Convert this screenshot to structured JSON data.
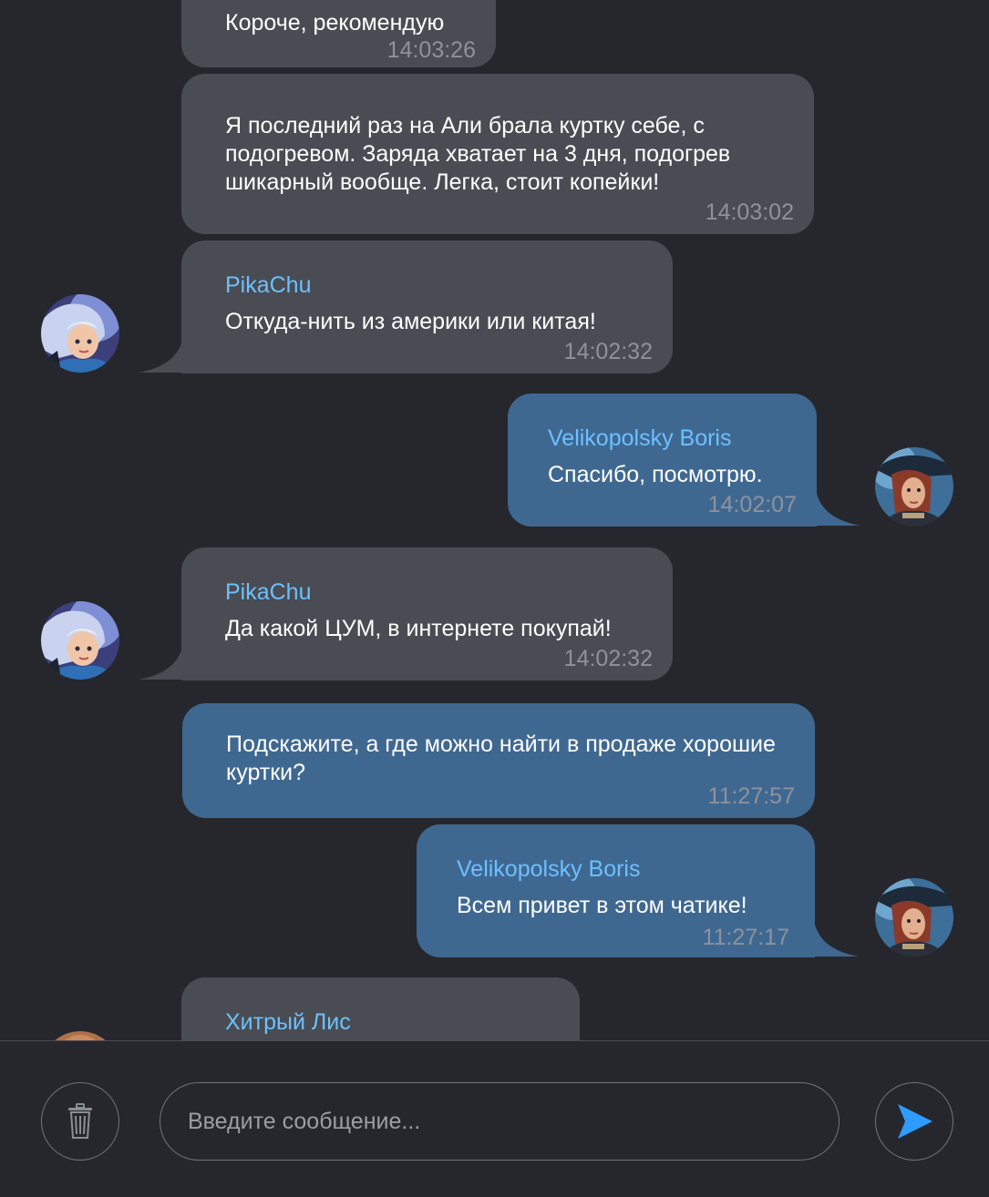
{
  "messages": [
    {
      "text": "Короче, рекомендую",
      "time": "14:03:26"
    },
    {
      "text": "Я последний раз на Али брала куртку себе, с подогревом. Заряда хватает на 3 дня, подогрев шикарный вообще. Легка, стоит копейки!",
      "time": "14:03:02"
    },
    {
      "author": "PikaChu",
      "text": "Откуда-нить из америки или китая!",
      "time": "14:02:32"
    },
    {
      "author": "Velikopolsky Boris",
      "text": "Спасибо, посмотрю.",
      "time": "14:02:07"
    },
    {
      "author": "PikaChu",
      "text": "Да какой ЦУМ, в интернете покупай!",
      "time": "14:02:32"
    },
    {
      "text": "Подскажите, а где можно найти в продаже хорошие куртки?",
      "time": "11:27:57"
    },
    {
      "author": "Velikopolsky Boris",
      "text": "Всем привет в этом чатике!",
      "time": "11:27:17"
    },
    {
      "author": "Хитрый Лис"
    }
  ],
  "composer": {
    "placeholder": "Введите сообщение..."
  },
  "icons": {
    "delete": "trash-icon",
    "send": "send-icon"
  },
  "colors": {
    "background": "#26272c",
    "incoming_bubble": "#4a4c53",
    "outgoing_bubble": "#3f6891",
    "author_name": "#6cc0ff",
    "timestamp": "#8e9299",
    "send_accent": "#2e9bff"
  }
}
